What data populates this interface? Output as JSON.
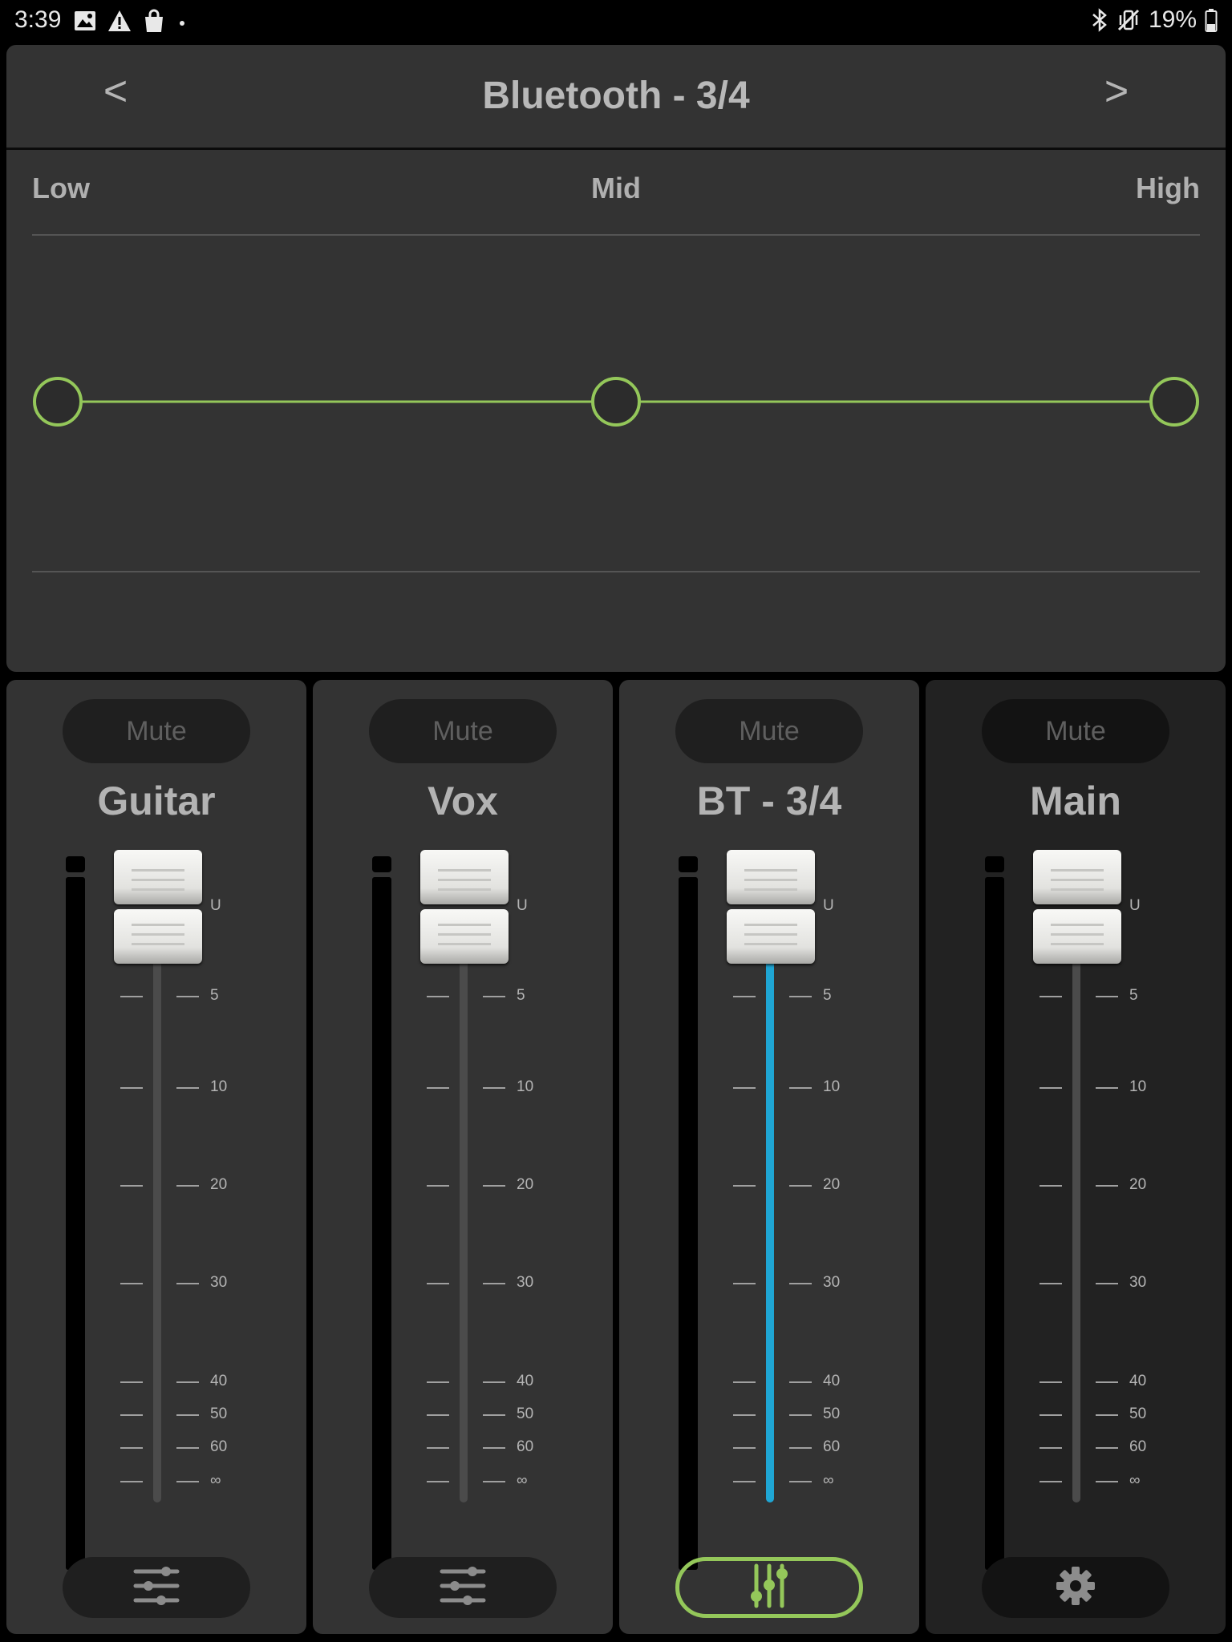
{
  "status_bar": {
    "time": "3:39",
    "battery": "19%",
    "left_icons": [
      "gallery-icon",
      "warning-icon",
      "shopping-bag-icon",
      "dot-icon"
    ],
    "right_icons": [
      "bluetooth-icon",
      "vibrate-mute-icon",
      "battery-icon"
    ]
  },
  "eq": {
    "prev_label": "<",
    "next_label": ">",
    "title": "Bluetooth - 3/4",
    "bands": [
      {
        "label": "Low",
        "gain_db": 0
      },
      {
        "label": "Mid",
        "gain_db": 0
      },
      {
        "label": "High",
        "gain_db": 0
      }
    ],
    "curve_color": "#94c75a"
  },
  "scale_labels": [
    "U",
    "5",
    "10",
    "20",
    "30",
    "40",
    "50",
    "60",
    "∞"
  ],
  "channels": [
    {
      "name": "Guitar",
      "mute_label": "Mute",
      "fader_db": 0,
      "active": false,
      "footer_icon": "sliders-icon"
    },
    {
      "name": "Vox",
      "mute_label": "Mute",
      "fader_db": 0,
      "active": false,
      "footer_icon": "sliders-icon"
    },
    {
      "name": "BT - 3/4",
      "mute_label": "Mute",
      "fader_db": 0,
      "active": true,
      "footer_icon": "mixer-faders-icon"
    },
    {
      "name": "Main",
      "mute_label": "Mute",
      "fader_db": 0,
      "active": false,
      "footer_icon": "gear-icon"
    }
  ],
  "colors": {
    "accent_green": "#94c75a",
    "active_track_blue": "#1fa6d4",
    "panel": "#333333",
    "main_panel": "#222222"
  }
}
